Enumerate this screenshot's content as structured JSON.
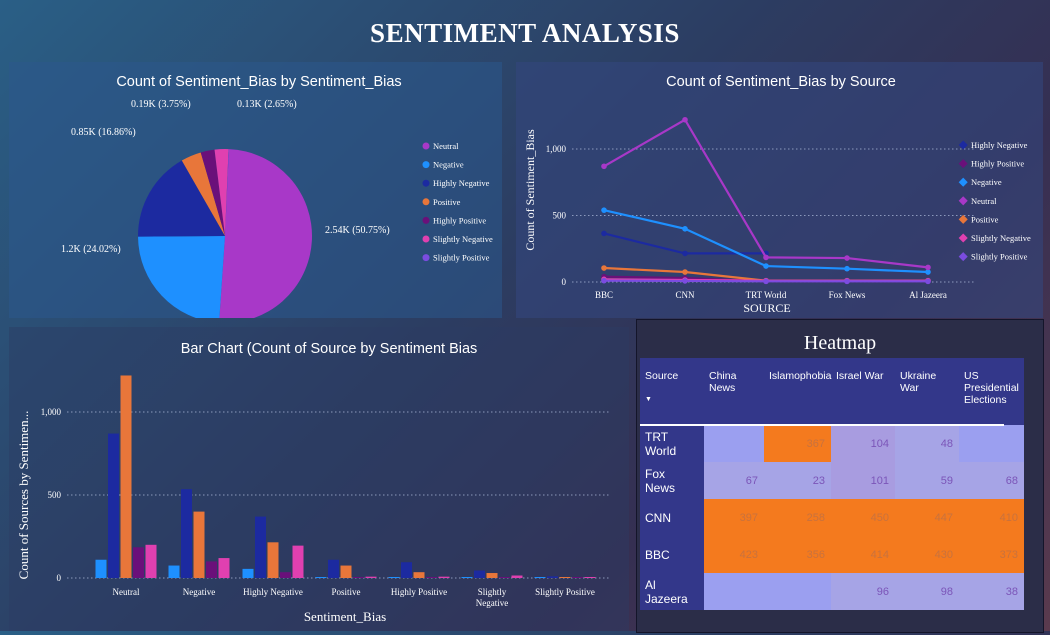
{
  "page_title": "SENTIMENT ANALYSIS",
  "colors": {
    "Neutral": "#a838c8",
    "Negative": "#1e90ff",
    "Highly Negative": "#1c2aa0",
    "Positive": "#e8763a",
    "Highly Positive": "#6a107a",
    "Slightly Negative": "#e040b0",
    "Slightly Positive": "#7b4ce0"
  },
  "chart_data": [
    {
      "type": "pie",
      "title": "Count of Sentiment_Bias by Sentiment_Bias",
      "slices": [
        {
          "name": "Neutral",
          "value": 2540,
          "label": "2.54K (50.75%)"
        },
        {
          "name": "Negative",
          "value": 1200,
          "label": "1.2K (24.02%)"
        },
        {
          "name": "Highly Negative",
          "value": 850,
          "label": "0.85K (16.86%)"
        },
        {
          "name": "Positive",
          "value": 190,
          "label": "0.19K (3.75%)"
        },
        {
          "name": "Highly Positive",
          "value": 130,
          "label": ""
        },
        {
          "name": "Slightly Negative",
          "value": 130,
          "label": "0.13K (2.65%)"
        },
        {
          "name": "Slightly Positive",
          "value": 3,
          "label": ""
        }
      ],
      "legend": [
        "Neutral",
        "Negative",
        "Highly Negative",
        "Positive",
        "Highly Positive",
        "Slightly Negative",
        "Slightly Positive"
      ]
    },
    {
      "type": "line",
      "title": "Count of Sentiment_Bias by Source",
      "xlabel": "SOURCE",
      "ylabel": "Count of Sentiment_Bias",
      "x": [
        "BBC",
        "CNN",
        "TRT World",
        "Fox News",
        "Al Jazeera"
      ],
      "ylim": [
        0,
        1250
      ],
      "yticks": [
        "0",
        "500",
        "1,000"
      ],
      "ytick_values": [
        0,
        500,
        1000
      ],
      "series": [
        {
          "name": "Highly Negative",
          "values": [
            365,
            215,
            215,
            null,
            null
          ]
        },
        {
          "name": "Highly Positive",
          "values": [
            40,
            30,
            5,
            5,
            5
          ]
        },
        {
          "name": "Negative",
          "values": [
            540,
            400,
            120,
            100,
            75
          ]
        },
        {
          "name": "Neutral",
          "values": [
            870,
            1220,
            185,
            180,
            110
          ]
        },
        {
          "name": "Positive",
          "values": [
            105,
            75,
            10,
            10,
            10
          ]
        },
        {
          "name": "Slightly Negative",
          "values": [
            20,
            15,
            10,
            10,
            10
          ]
        },
        {
          "name": "Slightly Positive",
          "values": [
            10,
            8,
            5,
            5,
            5
          ]
        }
      ],
      "legend": [
        "Highly Negative",
        "Highly Positive",
        "Negative",
        "Neutral",
        "Positive",
        "Slightly Negative",
        "Slightly Positive"
      ]
    },
    {
      "type": "bar",
      "title": "Bar Chart (Count of Source by Sentiment Bias",
      "xlabel": "Sentiment_Bias",
      "ylabel": "Count of Sources by Sentimen...",
      "ylim": [
        0,
        1250
      ],
      "yticks": [
        "0",
        "500",
        "1,000"
      ],
      "ytick_values": [
        0,
        500,
        1000
      ],
      "categories": [
        "Neutral",
        "Negative",
        "Highly Negative",
        "Positive",
        "Highly Positive",
        "Slightly Negative",
        "Slightly Positive"
      ],
      "category_labels": [
        [
          "Neutral"
        ],
        [
          "Negative"
        ],
        [
          "Highly Negative"
        ],
        [
          "Positive"
        ],
        [
          "Highly Positive"
        ],
        [
          "Slightly",
          "Negative"
        ],
        [
          "Slightly Positive"
        ]
      ],
      "series": [
        {
          "name": "Al Jazeera",
          "color": "#1e90ff",
          "values": [
            110,
            75,
            55,
            5,
            5,
            5,
            3
          ]
        },
        {
          "name": "BBC",
          "color": "#1c2aa0",
          "values": [
            870,
            535,
            370,
            110,
            95,
            45,
            10
          ]
        },
        {
          "name": "CNN",
          "color": "#e8763a",
          "values": [
            1220,
            400,
            215,
            75,
            35,
            30,
            5
          ]
        },
        {
          "name": "Fox News",
          "color": "#6a107a",
          "values": [
            185,
            100,
            35,
            3,
            3,
            3,
            2
          ]
        },
        {
          "name": "TRT World",
          "color": "#e040b0",
          "values": [
            200,
            120,
            195,
            8,
            8,
            15,
            3
          ]
        }
      ]
    },
    {
      "type": "heatmap",
      "title": "Heatmap",
      "row_header": "Source",
      "columns": [
        "China News",
        "Islamophobia",
        "Israel War",
        "Ukraine War",
        "US Presidential Elections"
      ],
      "rows": [
        {
          "source": "TRT World",
          "values": [
            null,
            367,
            104,
            48,
            null
          ]
        },
        {
          "source": "Fox News",
          "values": [
            67,
            23,
            101,
            59,
            68
          ]
        },
        {
          "source": "CNN",
          "values": [
            397,
            258,
            450,
            447,
            410
          ]
        },
        {
          "source": "BBC",
          "values": [
            423,
            356,
            414,
            430,
            373
          ]
        },
        {
          "source": "Al Jazeera",
          "values": [
            null,
            null,
            96,
            98,
            38
          ]
        }
      ]
    }
  ]
}
